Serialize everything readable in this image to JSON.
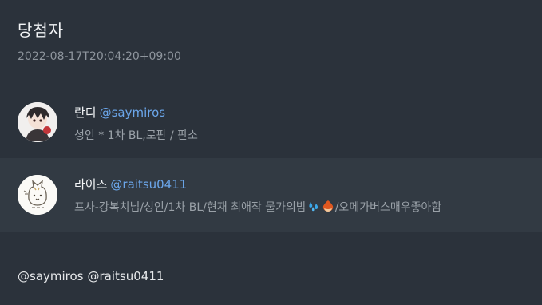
{
  "header": {
    "title": "당첨자",
    "timestamp": "2022-08-17T20:04:20+09:00"
  },
  "winners": [
    {
      "display_name": "란디",
      "handle": "@saymiros",
      "bio": "성인 * 1차 BL,로판 / 판소",
      "avatar_icon": "anime-character-avatar-icon"
    },
    {
      "display_name": "라이즈",
      "handle": "@raitsu0411",
      "bio_prefix": "프사-강복치님/성인/1차 BL/현재 최애작 물가의밤",
      "bio_emoji_1": "sweat-droplets-icon",
      "bio_emoji_2": "chestnut-icon",
      "bio_suffix": "/오메가버스매우좋아함",
      "avatar_icon": "cat-sketch-avatar-icon"
    }
  ],
  "mentions": [
    "@saymiros",
    "@raitsu0411"
  ],
  "colors": {
    "background": "#2b323b",
    "highlight_row": "#323a43",
    "link": "#6ba6ea",
    "muted_text": "#9aa1a8"
  }
}
